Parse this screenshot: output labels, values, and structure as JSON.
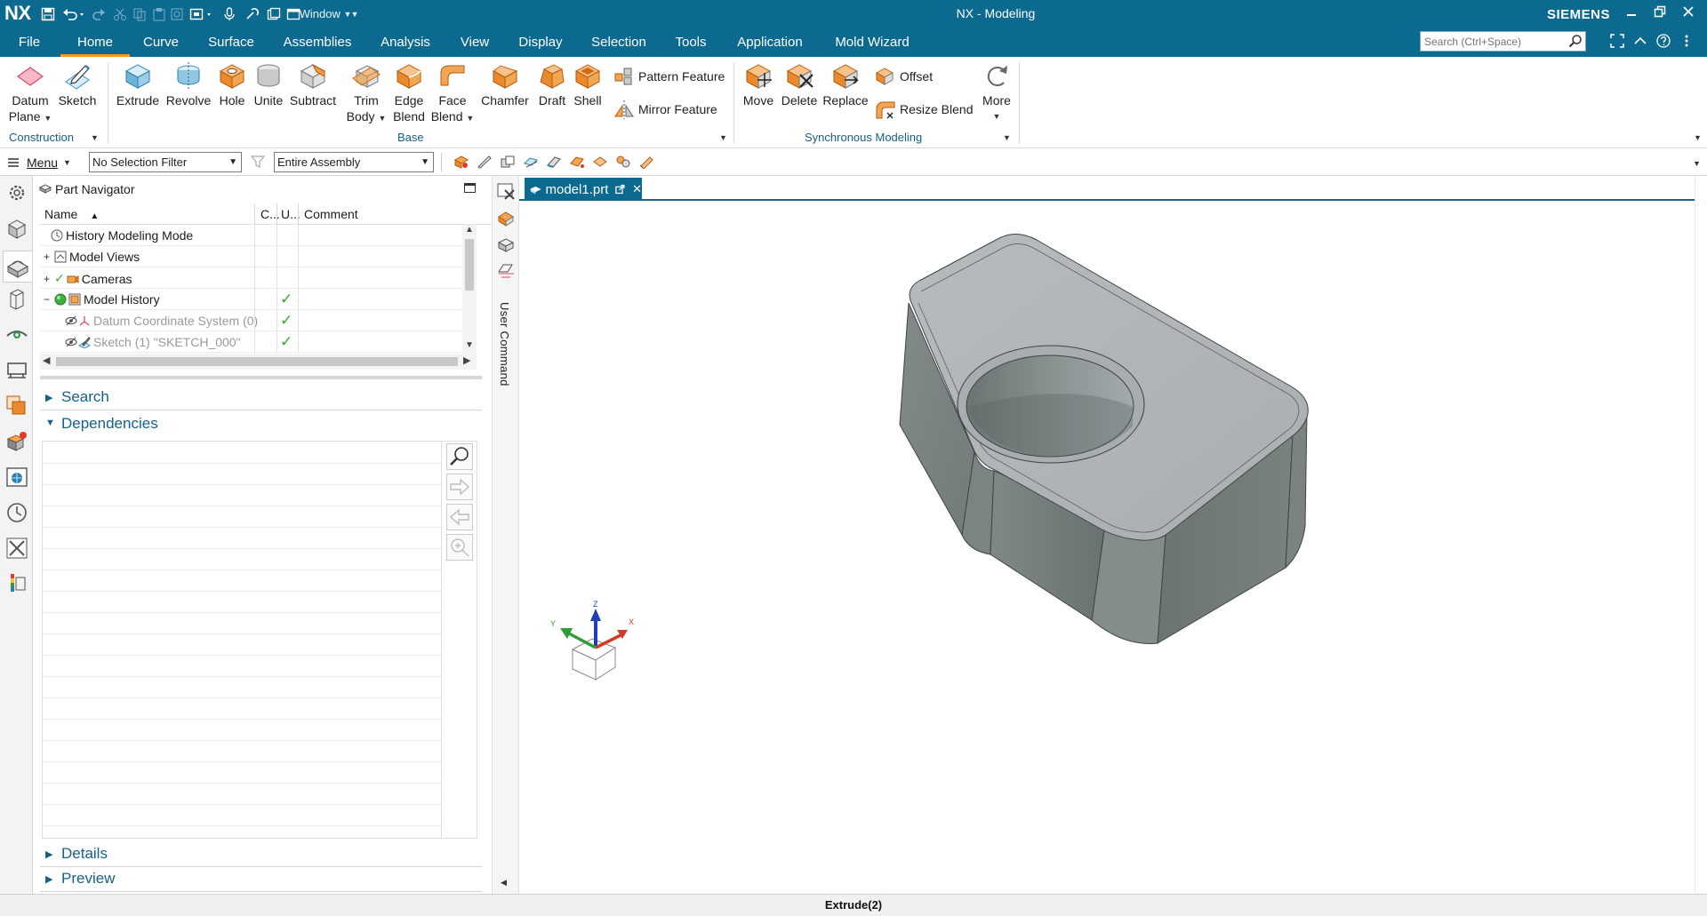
{
  "titlebar": {
    "logo": "NX",
    "window_menu": "Window",
    "app_title": "NX - Modeling",
    "brand": "SIEMENS"
  },
  "menu": {
    "tabs": [
      "File",
      "Home",
      "Curve",
      "Surface",
      "Assemblies",
      "Analysis",
      "View",
      "Display",
      "Selection",
      "Tools",
      "Application",
      "Mold Wizard"
    ],
    "active_tab": "Home",
    "search_placeholder": "Search (Ctrl+Space)"
  },
  "ribbon": {
    "construction": {
      "datum_plane": [
        "Datum",
        "Plane"
      ],
      "sketch": "Sketch",
      "label": "Construction"
    },
    "base": {
      "extrude": "Extrude",
      "revolve": "Revolve",
      "hole": "Hole",
      "unite": "Unite",
      "subtract": "Subtract",
      "trim_body": [
        "Trim",
        "Body"
      ],
      "edge_blend": [
        "Edge",
        "Blend"
      ],
      "face_blend": [
        "Face",
        "Blend"
      ],
      "chamfer": "Chamfer",
      "draft": "Draft",
      "shell": "Shell",
      "pattern_feature": "Pattern Feature",
      "mirror_feature": "Mirror Feature",
      "label": "Base"
    },
    "sync": {
      "move": "Move",
      "delete": "Delete",
      "replace": "Replace",
      "offset": "Offset",
      "resize_blend": "Resize Blend",
      "label": "Synchronous Modeling"
    },
    "more": "More"
  },
  "selection_bar": {
    "menu": "Menu",
    "filter": "No Selection Filter",
    "scope": "Entire Assembly"
  },
  "navigator": {
    "title": "Part Navigator",
    "columns": [
      "Name",
      "C...",
      "U...",
      "Comment"
    ],
    "rows": [
      {
        "name": "History Modeling Mode",
        "up_to_date": ""
      },
      {
        "name": "Model Views",
        "up_to_date": ""
      },
      {
        "name": "Cameras",
        "up_to_date": ""
      },
      {
        "name": "Model History",
        "up_to_date": "✓"
      },
      {
        "name": "Datum Coordinate System (0)",
        "up_to_date": "✓"
      },
      {
        "name": "Sketch (1) \"SKETCH_000\"",
        "up_to_date": "✓"
      }
    ],
    "sections": {
      "search": "Search",
      "dependencies": "Dependencies",
      "details": "Details",
      "preview": "Preview"
    }
  },
  "side_strip": {
    "vertical_label": "User Command"
  },
  "document": {
    "tab": "model1.prt"
  },
  "triad": {
    "x": "X",
    "y": "Y",
    "z": "Z"
  },
  "status": {
    "message": "Extrude(2)"
  },
  "colors": {
    "title_bar": "#0c6a91",
    "active_tab_underline": "#ff9a1f",
    "section_text": "#14618a",
    "model_top": "#b3b9ba",
    "model_side": "#6f7676"
  }
}
